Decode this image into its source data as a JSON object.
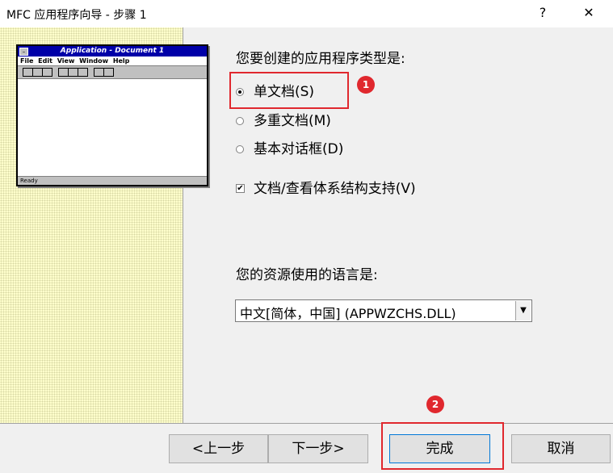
{
  "window": {
    "title": "MFC 应用程序向导 - 步骤 1",
    "help_glyph": "?",
    "close_glyph": "✕"
  },
  "preview": {
    "title": "Application - Document 1",
    "menu": [
      "File",
      "Edit",
      "View",
      "Window",
      "Help"
    ],
    "status": "Ready"
  },
  "app_type": {
    "question": "您要创建的应用程序类型是:",
    "options": [
      {
        "label": "单文档(S)",
        "checked": true
      },
      {
        "label": "多重文档(M)",
        "checked": false
      },
      {
        "label": "基本对话框(D)",
        "checked": false
      }
    ],
    "docview_label": "文档/查看体系结构支持(V)",
    "docview_checked": true
  },
  "language": {
    "question": "您的资源使用的语言是:",
    "selected": "中文[简体，中国] (APPWZCHS.DLL)"
  },
  "buttons": {
    "back": "<上一步",
    "next": "下一步>",
    "finish": "完成",
    "cancel": "取消"
  },
  "annotations": [
    "1",
    "2"
  ],
  "colors": {
    "annotation": "#e0282e",
    "left_panel": "#ffffcc",
    "preview_title": "#0000a8"
  }
}
